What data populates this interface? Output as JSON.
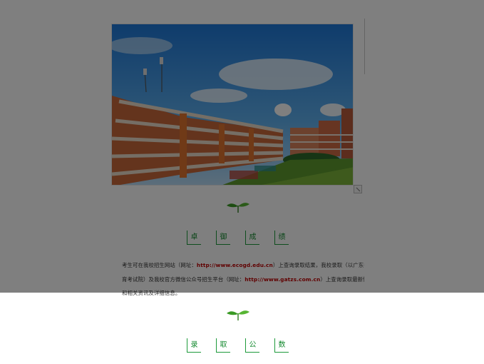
{
  "photo": {
    "alt_icon": "campus-photo"
  },
  "section1": {
    "heading_chars": [
      "卓",
      "御",
      "成",
      "绩"
    ]
  },
  "paragraph": {
    "line1_a": "考生可在我校招生网站（网址：",
    "line1_link": "http://www.ecogd.edu.cn",
    "line1_b": "）上查询录取结果，我校录取（以广东省教",
    "line2_a": "育考试院）及我校官方微信公众号招生平台（网址：",
    "line2_link": "http://www.gatzs.com.cn",
    "line2_b": "）上查询录取最新情况",
    "line3": "和相关资讯及详细信息。"
  },
  "section2": {
    "heading_chars": [
      "录",
      "取",
      "公",
      "数"
    ]
  },
  "colors": {
    "accent_green": "#1d9a3a",
    "link_red": "#c00000",
    "overlay": "rgba(0,0,0,0.5)"
  }
}
